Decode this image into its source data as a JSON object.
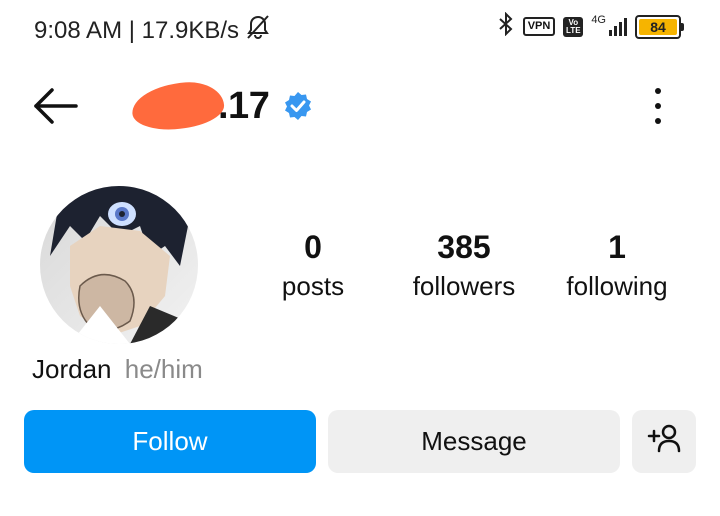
{
  "status_bar": {
    "time_speed": "9:08 AM | 17.9KB/s",
    "vpn_label": "VPN",
    "lte_top": "Vo",
    "lte_bottom": "LTE",
    "network_label": "4G",
    "battery_level": "84",
    "icons": [
      "bell-muted-icon",
      "bluetooth-icon",
      "signal-icon",
      "battery-icon"
    ],
    "battery_color": "#f6b400"
  },
  "header": {
    "username_suffix": ".17",
    "verified": true,
    "icons": [
      "back-arrow-icon",
      "verified-badge-icon",
      "more-options-icon"
    ],
    "verified_color": "#3897f0"
  },
  "profile": {
    "stats": [
      {
        "value": "0",
        "label": "posts"
      },
      {
        "value": "385",
        "label": "followers"
      },
      {
        "value": "1",
        "label": "following"
      }
    ],
    "name": "Jordan",
    "pronouns": "he/him"
  },
  "actions": {
    "follow_label": "Follow",
    "message_label": "Message",
    "add_user_icon": "add-user-icon",
    "follow_color": "#0095f6"
  }
}
